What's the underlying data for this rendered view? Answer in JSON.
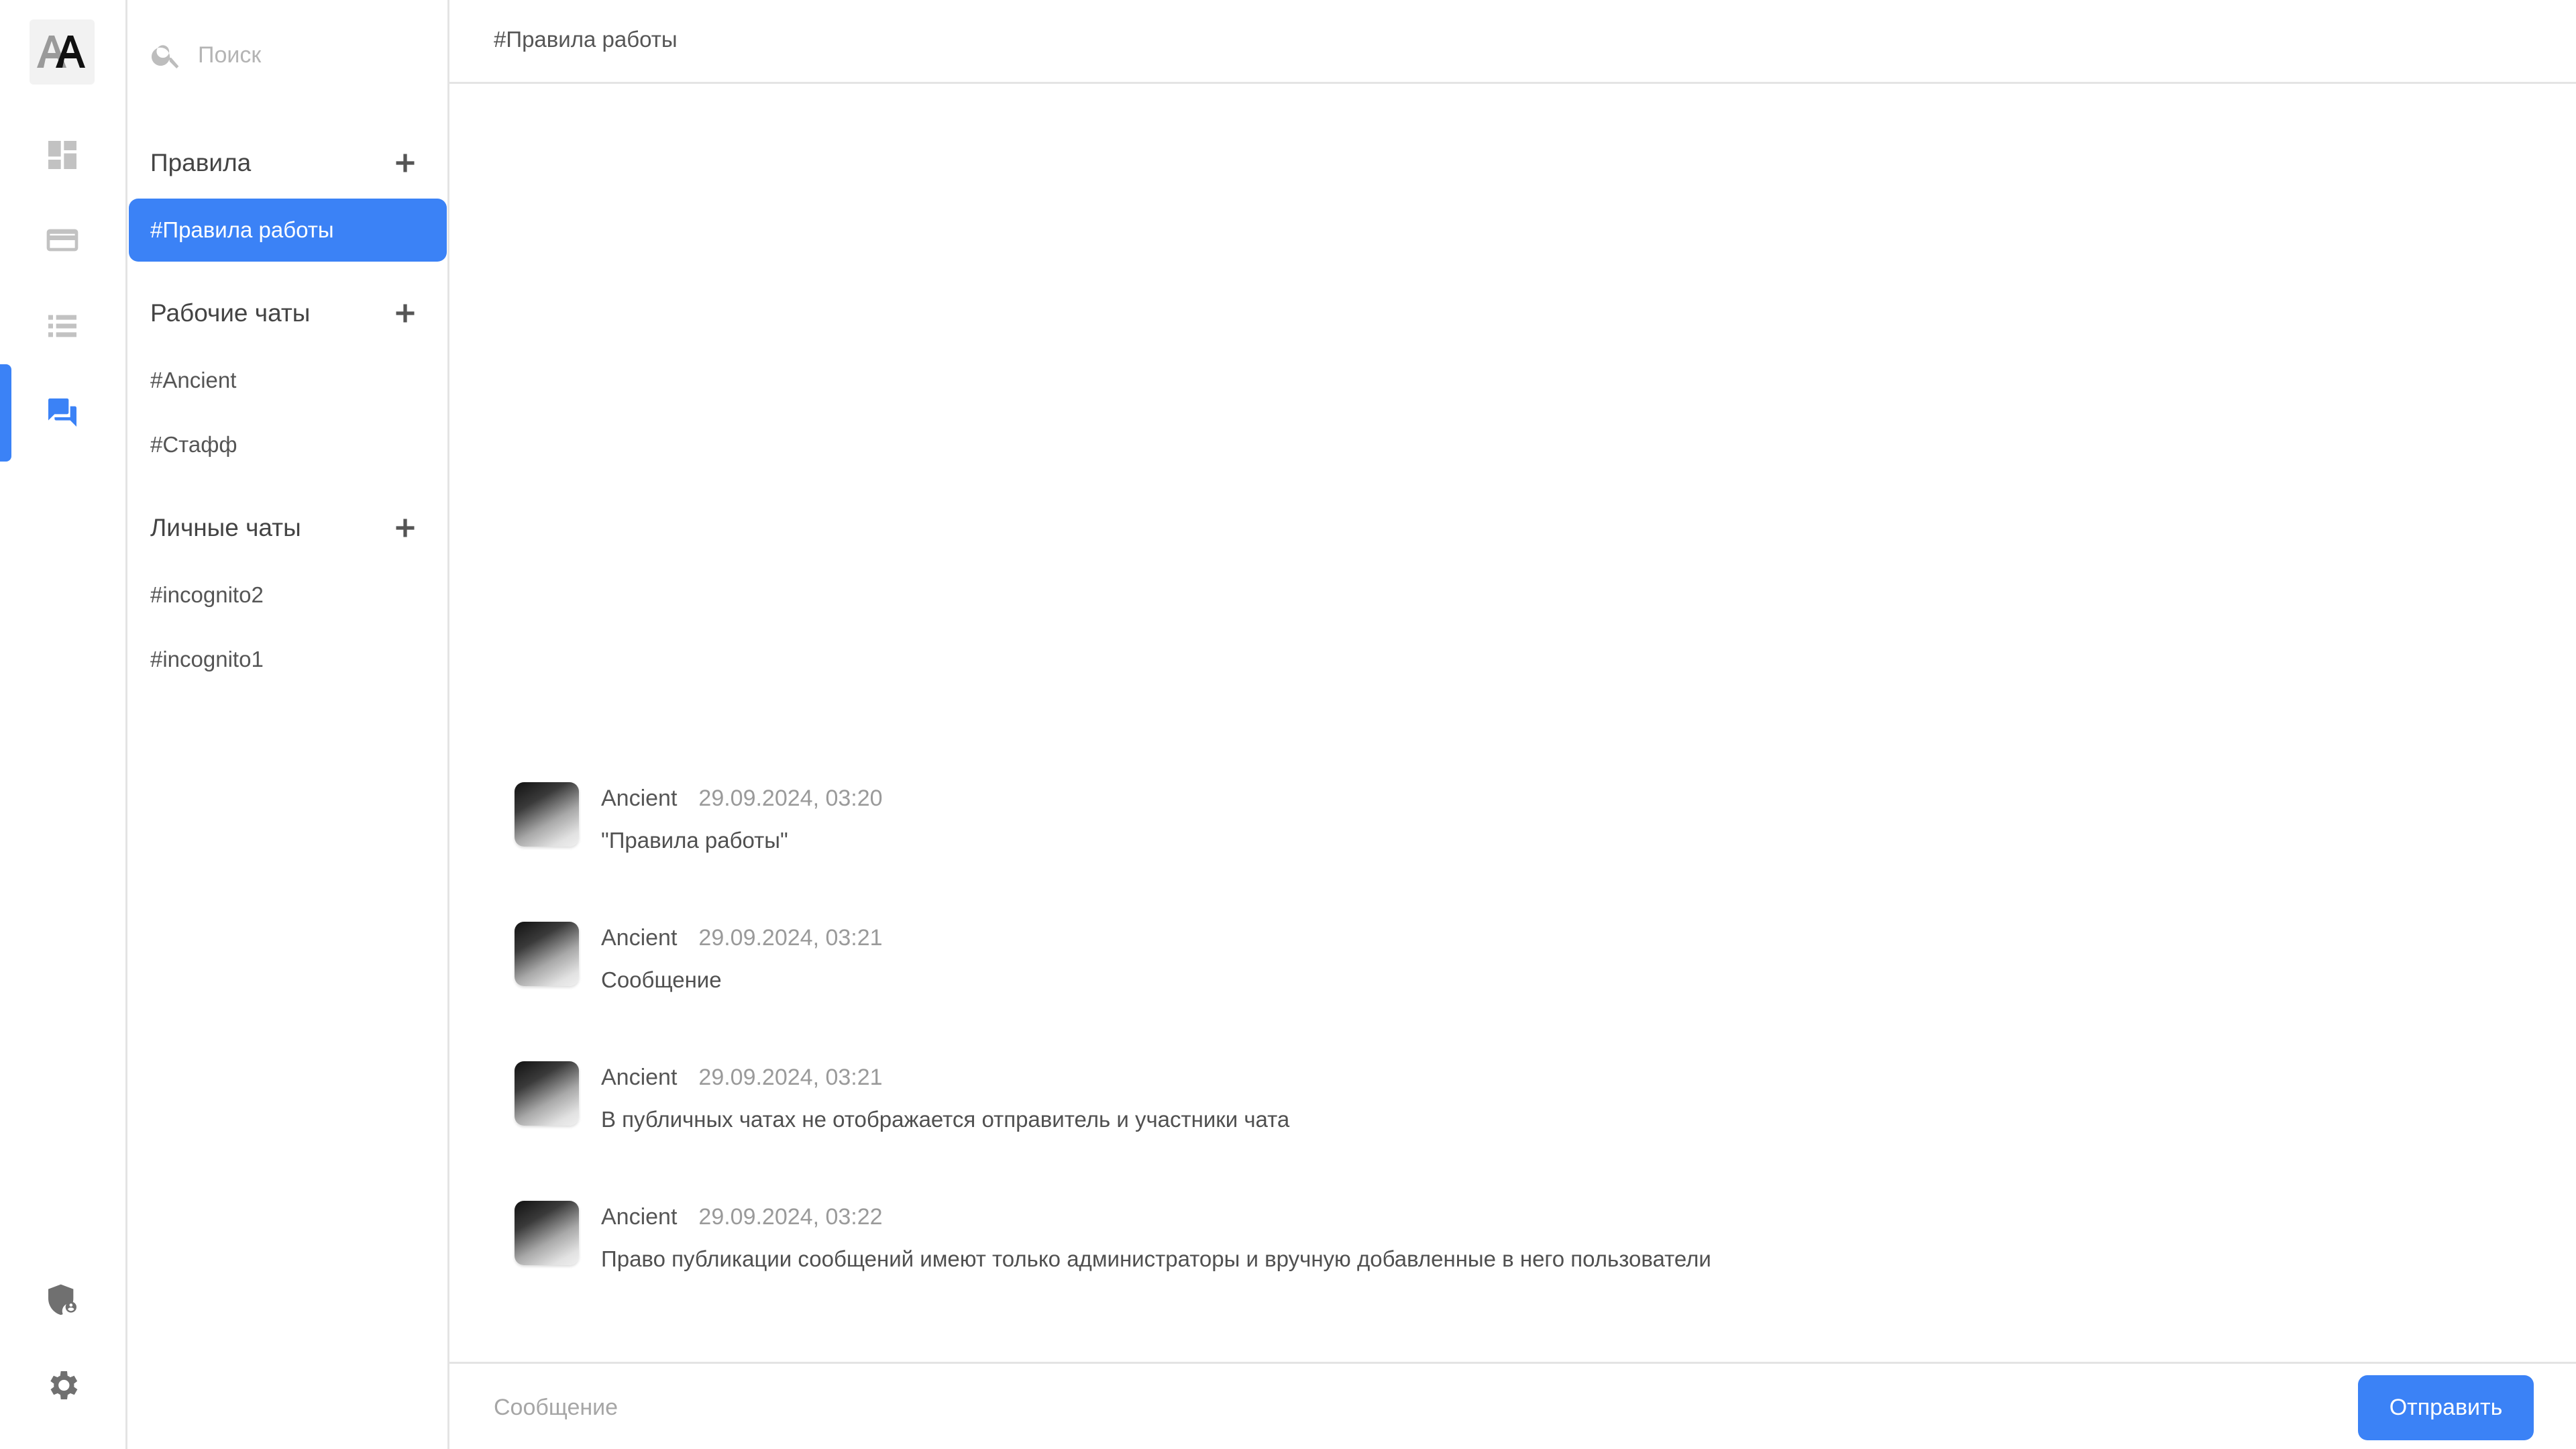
{
  "app": {
    "logo_icon": "aa-logo-icon"
  },
  "rail": {
    "items": [
      {
        "name": "dashboard",
        "icon": "dashboard-icon",
        "active": false
      },
      {
        "name": "wallet",
        "icon": "wallet-icon",
        "active": false
      },
      {
        "name": "list",
        "icon": "list-icon",
        "active": false
      },
      {
        "name": "chats",
        "icon": "chat-bubbles-icon",
        "active": true
      }
    ],
    "bottom_items": [
      {
        "name": "security",
        "icon": "shield-user-icon"
      },
      {
        "name": "settings",
        "icon": "gear-icon"
      }
    ]
  },
  "sidebar": {
    "search_placeholder": "Поиск",
    "sections": [
      {
        "title": "Правила",
        "channels": [
          {
            "label": "#Правила работы",
            "active": true
          }
        ]
      },
      {
        "title": "Рабочие чаты",
        "channels": [
          {
            "label": "#Ancient",
            "active": false
          },
          {
            "label": "#Стафф",
            "active": false
          }
        ]
      },
      {
        "title": "Личные чаты",
        "channels": [
          {
            "label": "#incognito2",
            "active": false
          },
          {
            "label": "#incognito1",
            "active": false
          }
        ]
      }
    ]
  },
  "chat": {
    "title": "#Правила работы",
    "messages": [
      {
        "author": "Ancient",
        "time": "29.09.2024, 03:20",
        "text": "\"Правила работы\""
      },
      {
        "author": "Ancient",
        "time": "29.09.2024, 03:21",
        "text": "Сообщение"
      },
      {
        "author": "Ancient",
        "time": "29.09.2024, 03:21",
        "text": "В публичных чатах не отображается отправитель и участники чата"
      },
      {
        "author": "Ancient",
        "time": "29.09.2024, 03:22",
        "text": "Право публикации сообщений имеют только администраторы и вручную добавленные в него пользователи"
      }
    ],
    "composer_placeholder": "Сообщение",
    "send_label": "Отправить"
  },
  "colors": {
    "accent": "#3b82f6",
    "divider": "#e4e4e4",
    "muted_icon": "#c2c2c2"
  }
}
